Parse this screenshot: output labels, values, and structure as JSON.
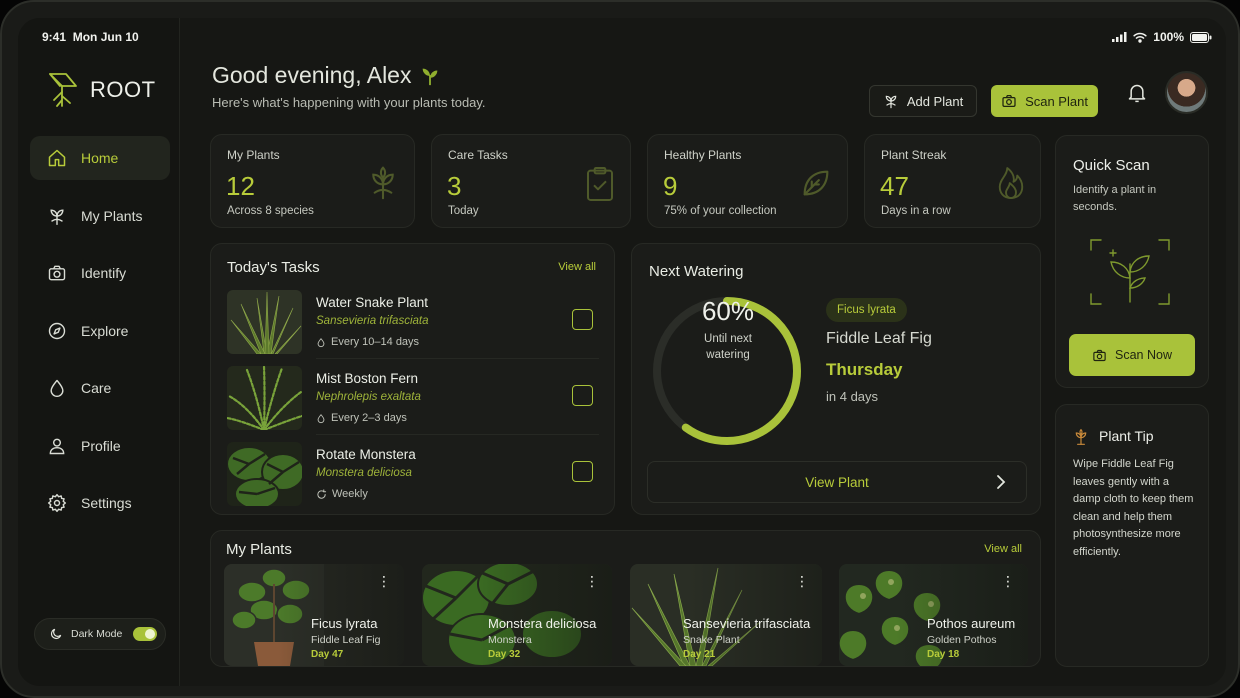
{
  "status": {
    "time": "9:41",
    "date": "Mon Jun 10",
    "battery": "100%"
  },
  "app": {
    "name": "ROOT"
  },
  "sidebar": {
    "items": [
      {
        "label": "Home",
        "icon": "home-icon"
      },
      {
        "label": "My Plants",
        "icon": "plant-icon"
      },
      {
        "label": "Identify",
        "icon": "camera-icon"
      },
      {
        "label": "Explore",
        "icon": "compass-icon"
      },
      {
        "label": "Care",
        "icon": "droplet-icon"
      },
      {
        "label": "Profile",
        "icon": "user-icon"
      },
      {
        "label": "Settings",
        "icon": "gear-icon"
      }
    ],
    "dark_mode_label": "Dark Mode",
    "dark_mode_on": true
  },
  "header": {
    "greeting": "Good evening, Alex",
    "subtitle": "Here's what's happening with your plants today.",
    "add_plant": "Add Plant",
    "scan_plant": "Scan Plant"
  },
  "stats": [
    {
      "label": "My Plants",
      "value": "12",
      "sub": "Across 8 species",
      "icon": "plant-icon"
    },
    {
      "label": "Care Tasks",
      "value": "3",
      "sub": "Today",
      "icon": "clipboard-icon"
    },
    {
      "label": "Healthy Plants",
      "value": "9",
      "sub": "75% of your collection",
      "icon": "leaf-icon"
    },
    {
      "label": "Plant Streak",
      "value": "47",
      "sub": "Days in a row",
      "icon": "flame-icon"
    }
  ],
  "tasks": {
    "title": "Today's Tasks",
    "view_all": "View all",
    "items": [
      {
        "name": "Water Snake Plant",
        "scientific": "Sansevieria trifasciata",
        "frequency": "Every 10–14 days",
        "freq_icon": "droplet-icon"
      },
      {
        "name": "Mist Boston Fern",
        "scientific": "Nephrolepis exaltata",
        "frequency": "Every 2–3 days",
        "freq_icon": "droplet-icon"
      },
      {
        "name": "Rotate Monstera",
        "scientific": "Monstera deliciosa",
        "frequency": "Weekly",
        "freq_icon": "rotate-icon"
      }
    ]
  },
  "next_watering": {
    "title": "Next Watering",
    "percent_label": "60%",
    "percent": 60,
    "ring_sub": "Until next watering",
    "badge": "Ficus lyrata",
    "plant_name": "Fiddle Leaf Fig",
    "day": "Thursday",
    "in_days": "in 4 days",
    "view_plant": "View Plant"
  },
  "quick_scan": {
    "title": "Quick Scan",
    "subtitle": "Identify a plant in seconds.",
    "button": "Scan Now"
  },
  "plant_tip": {
    "title": "Plant Tip",
    "body": "Wipe Fiddle Leaf Fig leaves gently with a damp cloth to keep them clean and help them photosynthesize more efficiently."
  },
  "my_plants": {
    "title": "My Plants",
    "view_all": "View all",
    "items": [
      {
        "name": "Ficus lyrata",
        "common": "Fiddle Leaf Fig",
        "day": "Day 47"
      },
      {
        "name": "Monstera deliciosa",
        "common": "Monstera",
        "day": "Day 32"
      },
      {
        "name": "Sansevieria trifasciata",
        "common": "Snake Plant",
        "day": "Day 21"
      },
      {
        "name": "Pothos aureum",
        "common": "Golden Pothos",
        "day": "Day 18"
      }
    ]
  },
  "colors": {
    "accent": "#a9c23a",
    "background": "#161714",
    "card": "#1b1c19"
  }
}
